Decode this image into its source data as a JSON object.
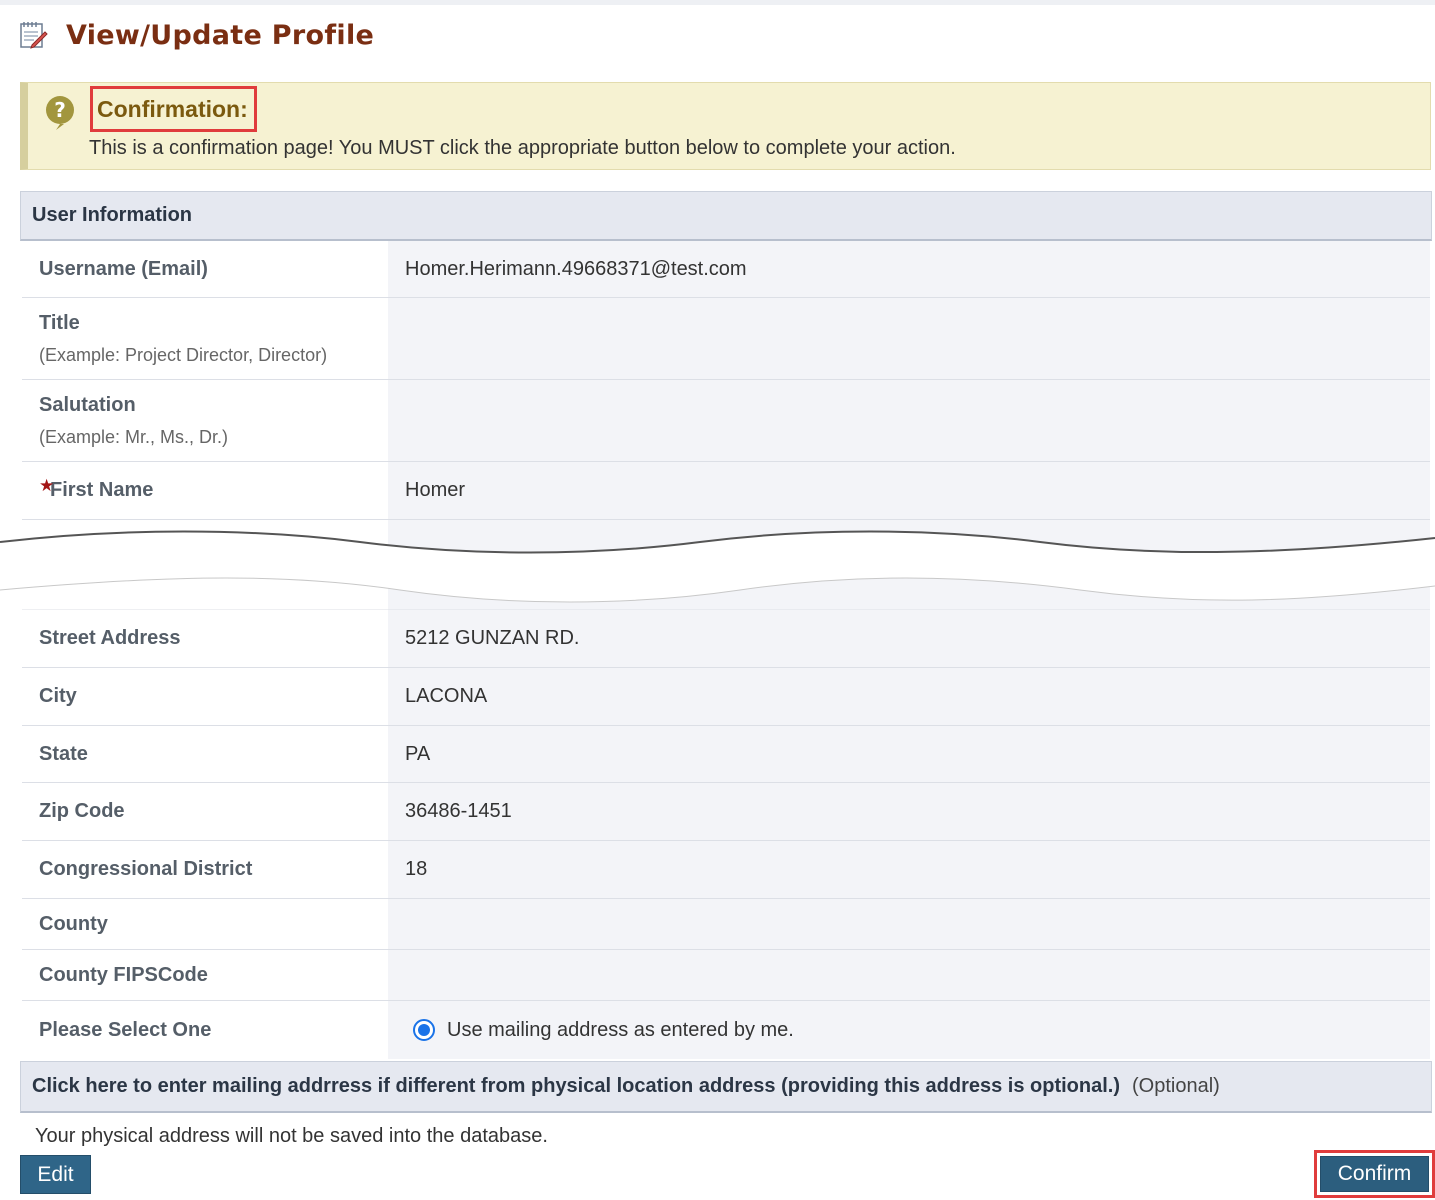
{
  "page": {
    "title": "View/Update Profile",
    "icon": "edit-document-icon"
  },
  "confirmation": {
    "heading": "Confirmation:",
    "message": "This is a confirmation page! You MUST click the appropriate button below to complete your action.",
    "icon": "question-mark-icon"
  },
  "user_information": {
    "section_title": "User Information",
    "rows": [
      {
        "label": "Username (Email)",
        "value": "Homer.Herimann.49668371@test.com"
      },
      {
        "label": "Title",
        "hint": "(Example: Project Director, Director)",
        "value": ""
      },
      {
        "label": "Salutation",
        "hint": "(Example: Mr., Ms., Dr.)",
        "value": ""
      },
      {
        "label": "First Name",
        "value": "Homer",
        "required": true
      }
    ]
  },
  "address": {
    "rows": [
      {
        "label": "Street Address",
        "value": "5212 GUNZAN RD."
      },
      {
        "label": "City",
        "value": "LACONA"
      },
      {
        "label": "State",
        "value": "PA"
      },
      {
        "label": "Zip Code",
        "value": "36486-1451"
      },
      {
        "label": "Congressional District",
        "value": "18"
      },
      {
        "label": "County",
        "value": ""
      },
      {
        "label": "County FIPSCode",
        "value": ""
      }
    ],
    "select_label": "Please Select One",
    "radio_option": "Use mailing address as entered by me.",
    "radio_checked": true
  },
  "mailing": {
    "section_title": "Click here to enter mailing addrress if different from physical location address (providing this address is optional.)",
    "optional_note": "(Optional)"
  },
  "footnote": "Your physical address will not be saved into the database.",
  "buttons": {
    "edit": "Edit",
    "confirm": "Confirm"
  },
  "colors": {
    "title": "#7a2e12",
    "button": "#2f6588",
    "highlight": "#e03c3c",
    "required": "#a31515"
  }
}
